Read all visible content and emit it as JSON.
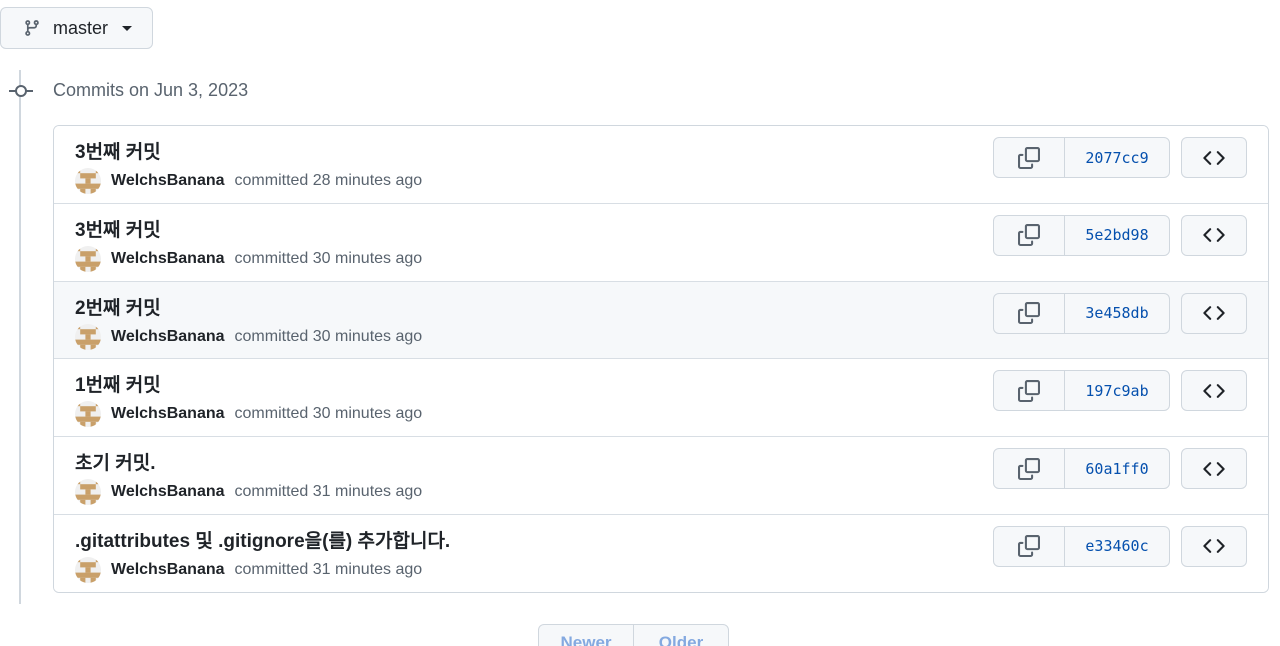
{
  "branch": {
    "name": "master"
  },
  "group": {
    "title": "Commits on Jun 3, 2023"
  },
  "commits": [
    {
      "title": "3번째 커밋",
      "author": "WelchsBanana",
      "committed": "committed 28 minutes ago",
      "sha": "2077cc9"
    },
    {
      "title": "3번째 커밋",
      "author": "WelchsBanana",
      "committed": "committed 30 minutes ago",
      "sha": "5e2bd98"
    },
    {
      "title": "2번째 커밋",
      "author": "WelchsBanana",
      "committed": "committed 30 minutes ago",
      "sha": "3e458db"
    },
    {
      "title": "1번째 커밋",
      "author": "WelchsBanana",
      "committed": "committed 30 minutes ago",
      "sha": "197c9ab"
    },
    {
      "title": "초기 커밋.",
      "author": "WelchsBanana",
      "committed": "committed 31 minutes ago",
      "sha": "60a1ff0"
    },
    {
      "title": ".gitattributes 및 .gitignore을(를) 추가합니다.",
      "author": "WelchsBanana",
      "committed": "committed 31 minutes ago",
      "sha": "e33460c"
    }
  ],
  "pagination": {
    "newer": "Newer",
    "older": "Older"
  },
  "icons": {
    "branch": "git-branch-icon",
    "commit": "git-commit-icon",
    "copy": "copy-icon",
    "browse": "code-icon",
    "avatar": "identicon"
  },
  "colors": {
    "sha": "#0550ae",
    "avatar": "#c9a06a",
    "row_hover": "#f6f8fa",
    "border": "#d0d7de"
  }
}
